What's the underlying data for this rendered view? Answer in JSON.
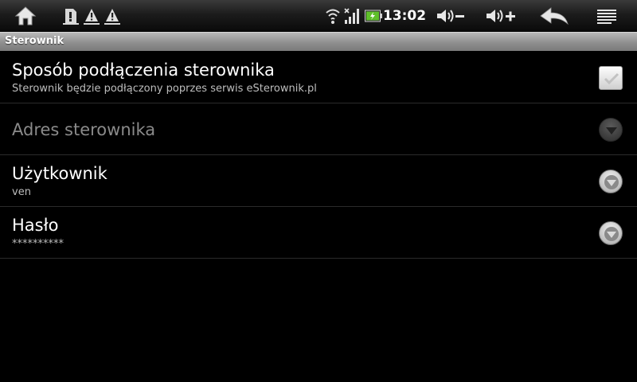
{
  "status_bar": {
    "time": "13:02",
    "icons": [
      "home-icon",
      "sd-card-warning-icon",
      "warning-icon",
      "warning-icon",
      "wifi-icon",
      "no-signal-icon",
      "battery-charging-icon",
      "volume-down-icon",
      "volume-up-icon",
      "back-icon",
      "menu-icon"
    ]
  },
  "screen": {
    "title": "Sterownik"
  },
  "preferences": [
    {
      "title": "Sposób podłączenia sterownika",
      "summary": "Sterownik będzie podłączony poprzes serwis eSterownik.pl",
      "widget": "checkbox",
      "checked": true,
      "enabled": true
    },
    {
      "title": "Adres sterownika",
      "summary": "",
      "widget": "dropdown",
      "enabled": false
    },
    {
      "title": "Użytkownik",
      "summary": "ven",
      "widget": "dropdown",
      "enabled": true
    },
    {
      "title": "Hasło",
      "summary": "**********",
      "widget": "dropdown",
      "enabled": true
    }
  ],
  "colors": {
    "background": "#000000",
    "title_bar": "#9a9a9a",
    "summary_text": "#bdbdbd",
    "disabled_text": "#8a8a8a",
    "battery_green": "#5fc02a"
  }
}
